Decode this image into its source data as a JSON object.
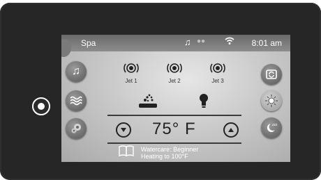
{
  "status": {
    "title": "Spa",
    "time": "8:01 am"
  },
  "jets": [
    {
      "label": "Jet 1"
    },
    {
      "label": "Jet 2"
    },
    {
      "label": "Jet 3"
    }
  ],
  "temperature": {
    "value": "75° F"
  },
  "watercare": {
    "line1": "Watercare: Beginner",
    "line2": "Heating to 100°F"
  }
}
